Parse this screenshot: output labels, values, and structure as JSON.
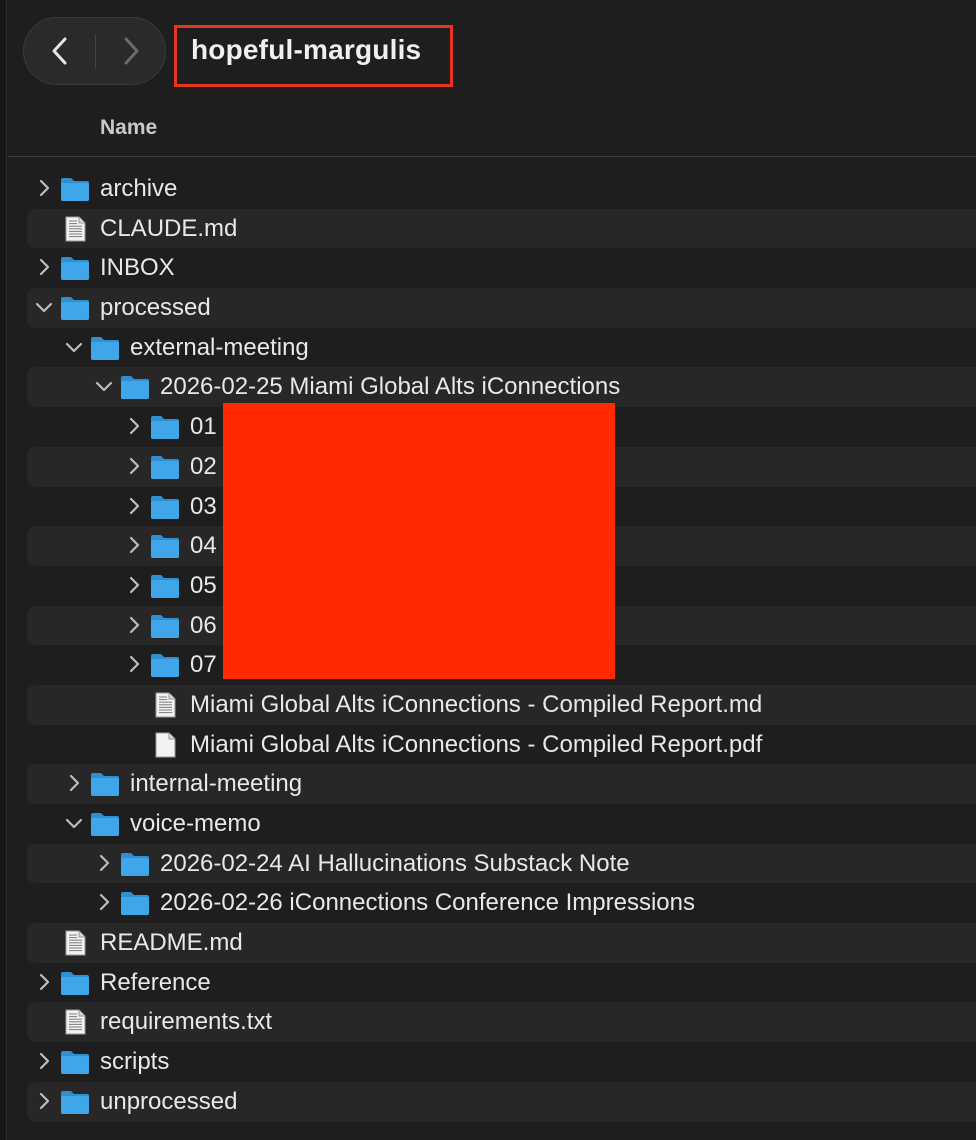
{
  "toolbar": {
    "back_icon": "chevron-left-icon",
    "forward_icon": "chevron-right-icon",
    "title": "hopeful-margulis"
  },
  "column_header": "Name",
  "colors": {
    "folder": "#3fa7e9",
    "highlight": "#e8341c",
    "redaction": "#ff2a00"
  },
  "rows": [
    {
      "label": "archive",
      "type": "folder",
      "depth": 0,
      "expanded": false
    },
    {
      "label": "CLAUDE.md",
      "type": "file",
      "depth": 0
    },
    {
      "label": "INBOX",
      "type": "folder",
      "depth": 0,
      "expanded": false
    },
    {
      "label": "processed",
      "type": "folder",
      "depth": 0,
      "expanded": true
    },
    {
      "label": "external-meeting",
      "type": "folder",
      "depth": 1,
      "expanded": true
    },
    {
      "label": "2026-02-25 Miami Global Alts iConnections",
      "type": "folder",
      "depth": 2,
      "expanded": true
    },
    {
      "label": "01",
      "type": "folder",
      "depth": 3,
      "expanded": false
    },
    {
      "label": "02",
      "type": "folder",
      "depth": 3,
      "expanded": false
    },
    {
      "label": "03",
      "type": "folder",
      "depth": 3,
      "expanded": false
    },
    {
      "label": "04",
      "type": "folder",
      "depth": 3,
      "expanded": false
    },
    {
      "label": "05",
      "type": "folder",
      "depth": 3,
      "expanded": false
    },
    {
      "label": "06",
      "type": "folder",
      "depth": 3,
      "expanded": false
    },
    {
      "label": "07",
      "type": "folder",
      "depth": 3,
      "expanded": false
    },
    {
      "label": "Miami Global Alts iConnections - Compiled Report.md",
      "type": "file",
      "depth": 3
    },
    {
      "label": "Miami Global Alts iConnections - Compiled Report.pdf",
      "type": "pdf",
      "depth": 3
    },
    {
      "label": "internal-meeting",
      "type": "folder",
      "depth": 1,
      "expanded": false
    },
    {
      "label": "voice-memo",
      "type": "folder",
      "depth": 1,
      "expanded": true
    },
    {
      "label": "2026-02-24 AI Hallucinations Substack Note",
      "type": "folder",
      "depth": 2,
      "expanded": false
    },
    {
      "label": "2026-02-26 iConnections Conference Impressions",
      "type": "folder",
      "depth": 2,
      "expanded": false
    },
    {
      "label": "README.md",
      "type": "file",
      "depth": 0
    },
    {
      "label": "Reference",
      "type": "folder",
      "depth": 0,
      "expanded": false
    },
    {
      "label": "requirements.txt",
      "type": "file",
      "depth": 0
    },
    {
      "label": "scripts",
      "type": "folder",
      "depth": 0,
      "expanded": false
    },
    {
      "label": "unprocessed",
      "type": "folder",
      "depth": 0,
      "expanded": false
    }
  ]
}
